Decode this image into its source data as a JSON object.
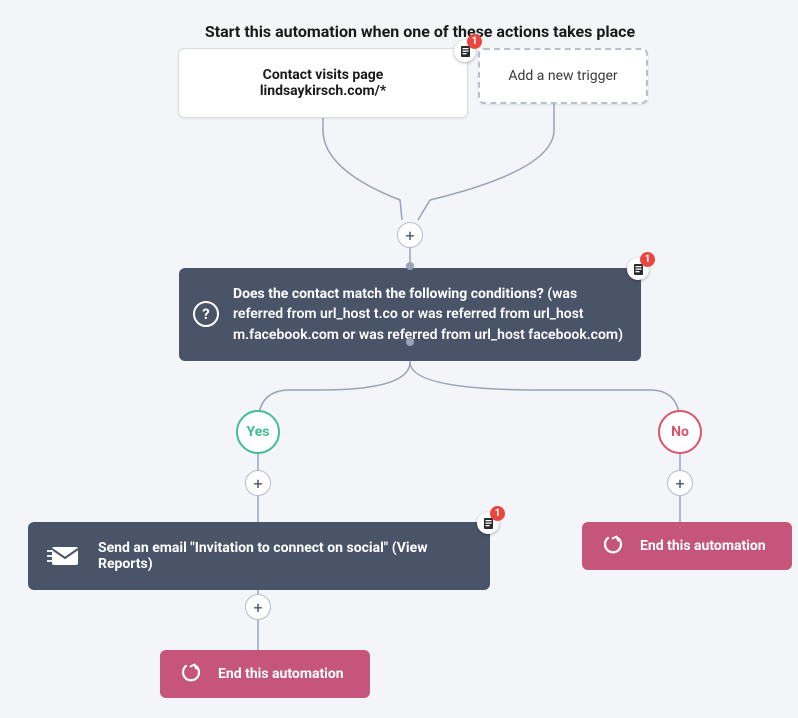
{
  "title": "Start this automation when one of these actions takes place",
  "trigger": {
    "label": "Contact visits page lindsaykirsch.com/*",
    "note_count": "1"
  },
  "add_trigger": {
    "label": "Add a new trigger"
  },
  "plus_label": "+",
  "condition": {
    "question_icon": "?",
    "text_prefix": "Does the contact match the following conditions?",
    "text_body": " (was referred from url_host t.co or was referred from url_host m.facebook.com or was referred from url_host facebook.com)",
    "note_count": "1"
  },
  "branches": {
    "yes": "Yes",
    "no": "No"
  },
  "email_action": {
    "prefix": "Send an email ",
    "name": "\"Invitation to connect on social\"",
    "suffix": " (View Reports)",
    "note_count": "1"
  },
  "end_action": {
    "label": "End this automation"
  }
}
